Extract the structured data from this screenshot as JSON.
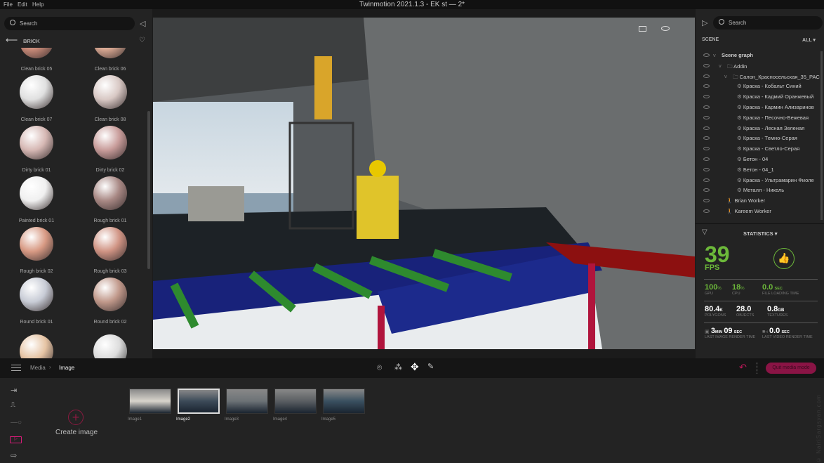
{
  "menu": [
    "File",
    "Edit",
    "Help"
  ],
  "title": "Twinmotion 2021.1.3 - EK st — 2*",
  "library": {
    "search_placeholder": "Search",
    "category": "BRICK",
    "items": [
      "Clean brick 05",
      "Clean brick 06",
      "Clean brick 07",
      "Clean brick 08",
      "Dirty brick 01",
      "Dirty brick 02",
      "Painted brick 01",
      "Rough brick 01",
      "Rough brick 02",
      "Rough brick 03",
      "Round brick 01",
      "Round brick 02"
    ]
  },
  "scene": {
    "search_placeholder": "Search",
    "label": "SCENE",
    "filter": "ALL",
    "tree": [
      {
        "label": "Scene graph",
        "level": 0,
        "icon": "chevron"
      },
      {
        "label": "Addin",
        "level": 1,
        "icon": "folder"
      },
      {
        "label": "Салон_Красносельская_35_РАС",
        "level": 2,
        "icon": "folder"
      },
      {
        "label": "Краска - Кобальт Синий",
        "level": 3,
        "icon": "material"
      },
      {
        "label": "Краска - Кадмий Оранжевый",
        "level": 3,
        "icon": "material"
      },
      {
        "label": "Краска - Кармин Ализаринов",
        "level": 3,
        "icon": "material"
      },
      {
        "label": "Краска - Песочно-Бежевая",
        "level": 3,
        "icon": "material"
      },
      {
        "label": "Краска - Лесная Зеленая",
        "level": 3,
        "icon": "material"
      },
      {
        "label": "Краска - Темно-Серая",
        "level": 3,
        "icon": "material"
      },
      {
        "label": "Краска - Светло-Серая",
        "level": 3,
        "icon": "material"
      },
      {
        "label": "Бетон - 04",
        "level": 3,
        "icon": "material"
      },
      {
        "label": "Бетон - 04_1",
        "level": 3,
        "icon": "material"
      },
      {
        "label": "Краска - Ультрамарин Фиоле",
        "level": 3,
        "icon": "material"
      },
      {
        "label": "Металл - Никель",
        "level": 3,
        "icon": "material"
      },
      {
        "label": "Brian Worker",
        "level": 1,
        "icon": "person"
      },
      {
        "label": "Kareem Worker",
        "level": 1,
        "icon": "person"
      }
    ]
  },
  "stats": {
    "title": "STATISTICS",
    "fps": "39",
    "fps_unit": "FPS",
    "gpu": "100",
    "gpu_unit": "%",
    "gpu_cap": "GPU",
    "cpu": "18",
    "cpu_unit": "%",
    "cpu_cap": "CPU",
    "load": "0.0",
    "load_unit": "SEC",
    "load_cap": "FILE LOADING TIME",
    "poly": "80.4",
    "poly_unit": "K",
    "poly_cap": "POLYGONS",
    "obj": "28.0",
    "obj_cap": "OBJECTS",
    "tex": "0.8",
    "tex_unit": "GB",
    "tex_cap": "TEXTURES",
    "img_min": "3",
    "img_min_unit": "MIN",
    "img_sec": "09",
    "img_sec_unit": "SEC",
    "img_cap": "LAST IMAGE RENDER TIME",
    "vid": "0.0",
    "vid_unit": "SEC",
    "vid_cap": "LAST VIDEO RENDER TIME"
  },
  "breadcrumb": [
    "Media",
    "Image"
  ],
  "quit_label": "Quit media mode",
  "create_label": "Create image",
  "images": [
    "Image1",
    "Image2",
    "Image3",
    "Image4",
    "Image5"
  ],
  "selected_image": "Image2",
  "watermark": "© NairiSargsyan.com",
  "colors": {
    "accent": "#c2185b",
    "stat_green": "#6cb83a"
  }
}
